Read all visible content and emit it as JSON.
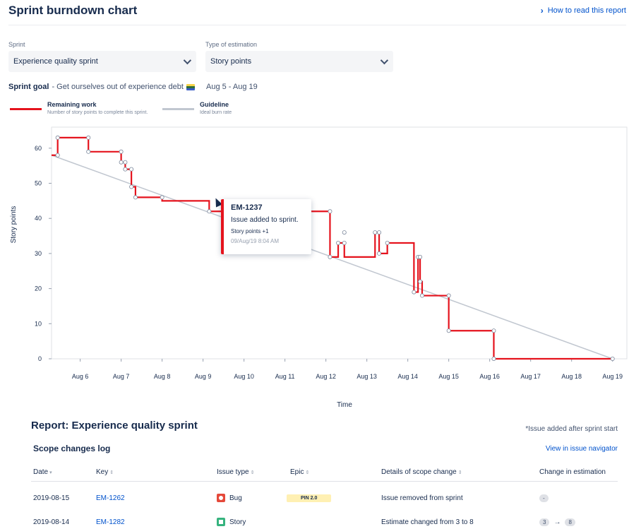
{
  "header": {
    "title": "Sprint burndown chart",
    "help_link": "How to read this report"
  },
  "filters": {
    "sprint_label": "Sprint",
    "sprint_value": "Experience quality sprint",
    "estimation_label": "Type of estimation",
    "estimation_value": "Story points"
  },
  "sprint_goal": {
    "label": "Sprint goal",
    "text": "- Get ourselves out of experience debt",
    "date_range": "Aug 5 - Aug 19"
  },
  "legend": [
    {
      "label": "Remaining work",
      "description": "Number of story points to complete this sprint.",
      "color": "#e5131d"
    },
    {
      "label": "Guideline",
      "description": "Ideal burn rate",
      "color": "#c1c7d0"
    }
  ],
  "tooltip": {
    "key": "EM-1237",
    "message": "Issue added to sprint.",
    "estimate": "Story points +1",
    "timestamp": "09/Aug/19 8:04 AM"
  },
  "chart_data": {
    "type": "line",
    "xlabel": "Time",
    "ylabel": "Story points",
    "ylim": [
      0,
      66
    ],
    "xlim": [
      5.3,
      19.35
    ],
    "x_tick_labels": [
      "Aug 6",
      "Aug 7",
      "Aug 8",
      "Aug 9",
      "Aug 10",
      "Aug 11",
      "Aug 12",
      "Aug 13",
      "Aug 14",
      "Aug 15",
      "Aug 16",
      "Aug 17",
      "Aug 18",
      "Aug 19"
    ],
    "x_ticks": [
      6,
      7,
      8,
      9,
      10,
      11,
      12,
      13,
      14,
      15,
      16,
      17,
      18,
      19
    ],
    "y_ticks": [
      0,
      10,
      20,
      30,
      40,
      50,
      60
    ],
    "grid": false,
    "series": [
      {
        "name": "Remaining work",
        "color": "#e5131d",
        "step": true,
        "points": [
          [
            5.3,
            58
          ],
          [
            5.45,
            58
          ],
          [
            5.45,
            63
          ],
          [
            6.2,
            63
          ],
          [
            6.2,
            59
          ],
          [
            7.0,
            59
          ],
          [
            7.0,
            56
          ],
          [
            7.1,
            56
          ],
          [
            7.1,
            54
          ],
          [
            7.25,
            54
          ],
          [
            7.25,
            49
          ],
          [
            7.35,
            49
          ],
          [
            7.35,
            46
          ],
          [
            8.0,
            46
          ],
          [
            8.0,
            45
          ],
          [
            9.15,
            45
          ],
          [
            9.15,
            42
          ],
          [
            12.1,
            42
          ],
          [
            12.1,
            29
          ],
          [
            12.3,
            29
          ],
          [
            12.3,
            33
          ],
          [
            12.45,
            33
          ],
          [
            12.45,
            29
          ],
          [
            13.2,
            29
          ],
          [
            13.2,
            36
          ],
          [
            13.3,
            36
          ],
          [
            13.3,
            30
          ],
          [
            13.5,
            30
          ],
          [
            13.5,
            33
          ],
          [
            14.15,
            33
          ],
          [
            14.15,
            19
          ],
          [
            14.25,
            19
          ],
          [
            14.25,
            29
          ],
          [
            14.3,
            29
          ],
          [
            14.3,
            22
          ],
          [
            14.35,
            22
          ],
          [
            14.35,
            18
          ],
          [
            15.0,
            18
          ],
          [
            15.0,
            8
          ],
          [
            16.1,
            8
          ],
          [
            16.1,
            0
          ],
          [
            19.0,
            0
          ]
        ],
        "markers": [
          [
            5.45,
            58
          ],
          [
            5.45,
            63
          ],
          [
            6.2,
            63
          ],
          [
            6.2,
            59
          ],
          [
            7.0,
            59
          ],
          [
            7.0,
            56
          ],
          [
            7.1,
            56
          ],
          [
            7.1,
            54
          ],
          [
            7.25,
            54
          ],
          [
            7.25,
            49
          ],
          [
            7.35,
            46
          ],
          [
            8.0,
            46
          ],
          [
            9.15,
            42
          ],
          [
            12.1,
            42
          ],
          [
            12.1,
            29
          ],
          [
            12.3,
            33
          ],
          [
            12.45,
            33
          ],
          [
            12.45,
            36
          ],
          [
            13.2,
            36
          ],
          [
            13.3,
            36
          ],
          [
            13.3,
            30
          ],
          [
            13.5,
            33
          ],
          [
            14.15,
            19
          ],
          [
            14.25,
            29
          ],
          [
            14.3,
            29
          ],
          [
            14.3,
            22
          ],
          [
            14.35,
            18
          ],
          [
            15.0,
            18
          ],
          [
            15.0,
            8
          ],
          [
            16.1,
            8
          ],
          [
            16.1,
            0
          ],
          [
            19.0,
            0
          ]
        ]
      },
      {
        "name": "Guideline",
        "color": "#c1c7d0",
        "step": false,
        "points": [
          [
            5.3,
            58
          ],
          [
            19.0,
            0
          ]
        ]
      }
    ]
  },
  "report": {
    "title": "Report: Experience quality sprint",
    "footnote": "*Issue added after sprint start",
    "log_title": "Scope changes log",
    "navigator_link": "View in issue navigator",
    "columns": [
      "Date",
      "Key",
      "Issue type",
      "Epic",
      "Details of scope change",
      "Change in estimation"
    ],
    "rows": [
      {
        "date": "2019-08-15",
        "key": "EM-1262",
        "type": "Bug",
        "type_icon": "bug-icon",
        "epic": "PIN 2.0",
        "details": "Issue removed from sprint",
        "est_from": "-",
        "est_to": ""
      },
      {
        "date": "2019-08-14",
        "key": "EM-1282",
        "type": "Story",
        "type_icon": "story-icon",
        "epic": "",
        "details": "Estimate changed from 3 to 8",
        "est_from": "3",
        "est_to": "8"
      }
    ]
  }
}
